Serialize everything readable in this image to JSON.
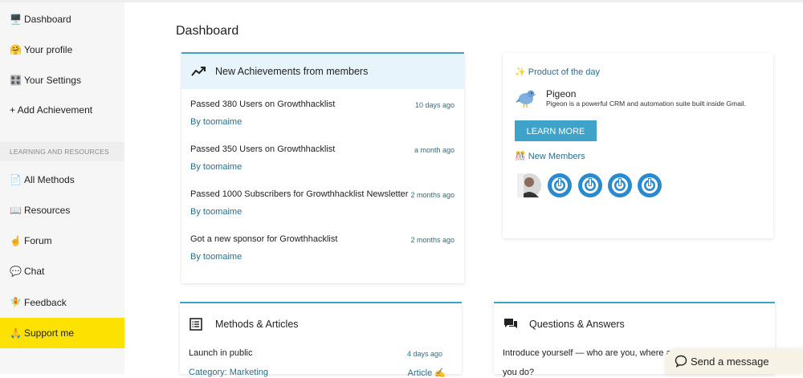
{
  "sidebar": {
    "items": [
      {
        "icon": "🖥️",
        "label": "Dashboard"
      },
      {
        "icon": "🤗",
        "label": "Your profile"
      },
      {
        "icon": "🎛️",
        "label": "Your Settings"
      },
      {
        "icon": "",
        "label": "+ Add Achievement"
      }
    ],
    "section_label": "LEARNING AND RESOURCES",
    "resources": [
      {
        "icon": "📄",
        "label": "All Methods"
      },
      {
        "icon": "📖",
        "label": "Resources"
      },
      {
        "icon": "☝️",
        "label": "Forum"
      },
      {
        "icon": "💬",
        "label": "Chat"
      },
      {
        "icon": "🧚",
        "label": "Feedback"
      },
      {
        "icon": "🙏",
        "label": "Support me"
      }
    ]
  },
  "main": {
    "title": "Dashboard",
    "achievements": {
      "title": "New Achievements from members",
      "items": [
        {
          "title": "Passed 380 Users on Growthhacklist",
          "time": "10 days ago",
          "by": "By toomaime"
        },
        {
          "title": "Passed 350 Users on Growthhacklist",
          "time": "a month ago",
          "by": "By toomaime"
        },
        {
          "title": "Passed 1000 Subscribers for Growthhacklist Newsletter",
          "time": "2 months ago",
          "by": "By toomaime"
        },
        {
          "title": "Got a new sponsor for Growthhacklist",
          "time": "2 months ago",
          "by": "By toomaime"
        }
      ]
    },
    "product": {
      "title_icon": "✨",
      "title": "Product of the day",
      "name": "Pigeon",
      "description": "Pigeon is a powerful CRM and automation suite built inside Gmail.",
      "button": "LEARN MORE",
      "new_members_icon": "🎊",
      "new_members": "New Members"
    },
    "articles": {
      "title": "Methods & Articles",
      "items": [
        {
          "title": "Launch in public",
          "time": "4 days ago",
          "category": "Category: Marketing",
          "type": "Article ✍️"
        }
      ]
    },
    "questions": {
      "title": "Questions & Answers",
      "line1": "Introduce yourself — who are you, where a",
      "line2": "you do?"
    }
  },
  "chat_widget": {
    "label": "Send a message"
  },
  "colors": {
    "accent": "#3fa2c8",
    "link": "#2a6e8a",
    "highlight": "#fde100"
  }
}
